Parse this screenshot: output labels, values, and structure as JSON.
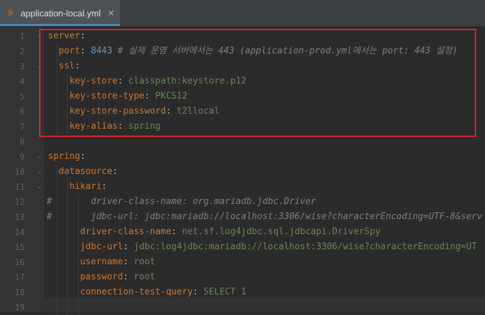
{
  "tab": {
    "title": "application-local.yml",
    "icon": "yaml-file-icon",
    "close": "×"
  },
  "lines": [
    {
      "n": "1",
      "indent": 0,
      "tokens": [
        {
          "t": "server",
          "c": "k"
        },
        {
          "t": ":",
          "c": "p"
        }
      ]
    },
    {
      "n": "2",
      "indent": 2,
      "tokens": [
        {
          "t": "port",
          "c": "k"
        },
        {
          "t": ": ",
          "c": "p"
        },
        {
          "t": "8443",
          "c": "n"
        },
        {
          "t": " # 실제 운영 서버에서는 443 (application-prod.yml에서는 port: 443 설정)",
          "c": "c"
        }
      ]
    },
    {
      "n": "3",
      "indent": 2,
      "tokens": [
        {
          "t": "ssl",
          "c": "k"
        },
        {
          "t": ":",
          "c": "p"
        }
      ]
    },
    {
      "n": "4",
      "indent": 4,
      "tokens": [
        {
          "t": "key-store",
          "c": "k"
        },
        {
          "t": ": ",
          "c": "p"
        },
        {
          "t": "classpath:keystore.p12",
          "c": "v"
        }
      ]
    },
    {
      "n": "5",
      "indent": 4,
      "tokens": [
        {
          "t": "key-store-type",
          "c": "k"
        },
        {
          "t": ": ",
          "c": "p"
        },
        {
          "t": "PKCS12",
          "c": "v"
        }
      ]
    },
    {
      "n": "6",
      "indent": 4,
      "tokens": [
        {
          "t": "key-store-password",
          "c": "k"
        },
        {
          "t": ": ",
          "c": "p"
        },
        {
          "t": "t2llocal",
          "c": "v"
        }
      ]
    },
    {
      "n": "7",
      "indent": 4,
      "tokens": [
        {
          "t": "key-alias",
          "c": "k"
        },
        {
          "t": ": ",
          "c": "p"
        },
        {
          "t": "spring",
          "c": "v"
        }
      ]
    },
    {
      "n": "8",
      "indent": 0,
      "tokens": []
    },
    {
      "n": "9",
      "indent": 0,
      "tokens": [
        {
          "t": "spring",
          "c": "k"
        },
        {
          "t": ":",
          "c": "p"
        }
      ]
    },
    {
      "n": "10",
      "indent": 2,
      "tokens": [
        {
          "t": "datasource",
          "c": "k"
        },
        {
          "t": ":",
          "c": "p"
        }
      ]
    },
    {
      "n": "11",
      "indent": 4,
      "tokens": [
        {
          "t": "hikari",
          "c": "k"
        },
        {
          "t": ":",
          "c": "p"
        }
      ]
    },
    {
      "n": "12",
      "indent": 0,
      "hash": "#",
      "tokens": [
        {
          "t": "        driver-class-name: org.mariadb.jdbc.Driver",
          "c": "c"
        }
      ]
    },
    {
      "n": "13",
      "indent": 0,
      "hash": "#",
      "tokens": [
        {
          "t": "        jdbc-url: jdbc:mariadb://localhost:3306/wise?characterEncoding=UTF-8&serv",
          "c": "c"
        }
      ]
    },
    {
      "n": "14",
      "indent": 6,
      "tokens": [
        {
          "t": "driver-class-name",
          "c": "k"
        },
        {
          "t": ": ",
          "c": "p"
        },
        {
          "t": "net.sf.log4jdbc.sql.jdbcapi.DriverSpy",
          "c": "v"
        }
      ]
    },
    {
      "n": "15",
      "indent": 6,
      "tokens": [
        {
          "t": "jdbc-url",
          "c": "k"
        },
        {
          "t": ": ",
          "c": "p"
        },
        {
          "t": "jdbc:log4jdbc:mariadb://localhost:3306/wise?characterEncoding=UT",
          "c": "v"
        }
      ]
    },
    {
      "n": "16",
      "indent": 6,
      "tokens": [
        {
          "t": "username",
          "c": "k"
        },
        {
          "t": ": ",
          "c": "p"
        },
        {
          "t": "root",
          "c": "v"
        }
      ]
    },
    {
      "n": "17",
      "indent": 6,
      "tokens": [
        {
          "t": "password",
          "c": "k"
        },
        {
          "t": ": ",
          "c": "p"
        },
        {
          "t": "root",
          "c": "v"
        }
      ]
    },
    {
      "n": "18",
      "indent": 6,
      "tokens": [
        {
          "t": "connection-test-query",
          "c": "k"
        },
        {
          "t": ": ",
          "c": "p"
        },
        {
          "t": "SELECT 1",
          "c": "v"
        }
      ]
    },
    {
      "n": "19",
      "indent": 0,
      "tokens": []
    }
  ],
  "folds": [
    "1",
    "3",
    "9",
    "10",
    "11"
  ],
  "colors": {
    "key": "#cc7832",
    "value": "#6a8759",
    "number": "#6897bb",
    "comment": "#808080",
    "highlight_box": "#e0242a"
  }
}
